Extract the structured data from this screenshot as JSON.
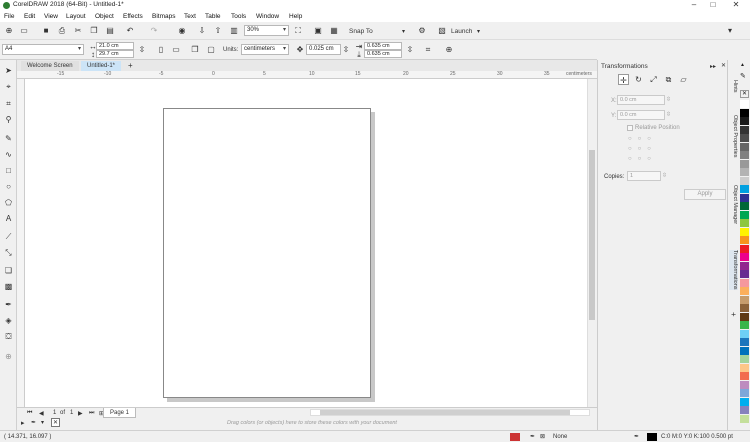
{
  "title": "CorelDRAW 2018 (64-Bit) - Untitled-1*",
  "menu": [
    "File",
    "Edit",
    "View",
    "Layout",
    "Object",
    "Effects",
    "Bitmaps",
    "Text",
    "Table",
    "Tools",
    "Window",
    "Help"
  ],
  "toolbar": {
    "zoom": "30%",
    "snap_to": "Snap To",
    "launch": "Launch"
  },
  "property_bar": {
    "page_size": "A4",
    "width": "21.0 cm",
    "height": "29.7 cm",
    "units_label": "Units:",
    "units": "centimeters",
    "nudge": "0.025 cm",
    "dup_x": "0.635 cm",
    "dup_y": "0.635 cm"
  },
  "doc_tabs": [
    "Welcome Screen",
    "Untitled-1*"
  ],
  "ruler": {
    "h_ticks": [
      "-15",
      "-10",
      "-5",
      "0",
      "5",
      "10",
      "15",
      "20",
      "25",
      "30",
      "35"
    ],
    "unit": "centimeters"
  },
  "page_nav": {
    "current": "1",
    "of": "of",
    "total": "1",
    "page_tab": "Page 1"
  },
  "palette_hint": "Drag colors (or objects) here to store these colors with your document",
  "status": {
    "coords": "( 14.371, 16.097 )",
    "fill": "None",
    "outline": "C:0 M:0 Y:0 K:100  0.500 pt"
  },
  "docker": {
    "title": "Transformations",
    "x_label": "X:",
    "x_value": "0.0 cm",
    "y_label": "Y:",
    "y_value": "0.0 cm",
    "relative": "Relative Position",
    "copies_label": "Copies:",
    "copies": "1",
    "apply": "Apply"
  },
  "side_tabs": [
    "Hints",
    "Object Properties",
    "Object Manager",
    "Transformations"
  ],
  "colors": {
    "accent": "#cce4f7",
    "page_border": "#888888",
    "shadow": "#c8c8c8"
  },
  "palette": [
    "#ffffff",
    "#000000",
    "#1a1a1a",
    "#333333",
    "#4d4d4d",
    "#666666",
    "#808080",
    "#999999",
    "#b3b3b3",
    "#cccccc",
    "#00a0e0",
    "#2e3192",
    "#006837",
    "#00a651",
    "#8dc63f",
    "#fff200",
    "#f7941d",
    "#ed1c24",
    "#ec008c",
    "#92278f",
    "#662d91",
    "#f5989d",
    "#fbaf5d",
    "#c69c6d",
    "#8c6239",
    "#603913",
    "#39b54a",
    "#6dcff6",
    "#1b75bc",
    "#0072bc",
    "#a3d39c",
    "#fdc689",
    "#f26c4f",
    "#bd8cbf",
    "#7da7d9",
    "#00aeef",
    "#8781bd",
    "#c4df9b"
  ]
}
